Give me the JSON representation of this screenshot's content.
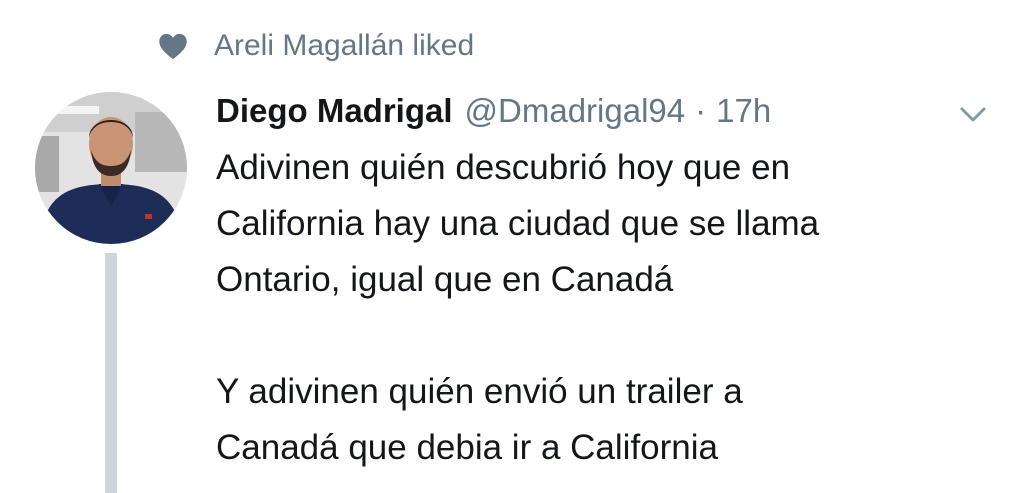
{
  "social_context": {
    "icon": "heart-icon",
    "text": "Areli Magallán liked"
  },
  "tweet": {
    "author_name": "Diego Madrigal",
    "author_handle": "@Dmadrigal94",
    "separator": "·",
    "timestamp": "17h",
    "menu_icon": "chevron-down-icon",
    "lines": [
      "Adivinen quién descubrió hoy que en",
      "California hay una ciudad que se llama",
      "Ontario, igual que en Canadá",
      "",
      "Y adivinen quién envió un trailer a",
      "Canadá que debia ir a California"
    ]
  },
  "colors": {
    "primary_text": "#14171a",
    "secondary_text": "#657786",
    "thread_line": "#ccd6dd"
  }
}
